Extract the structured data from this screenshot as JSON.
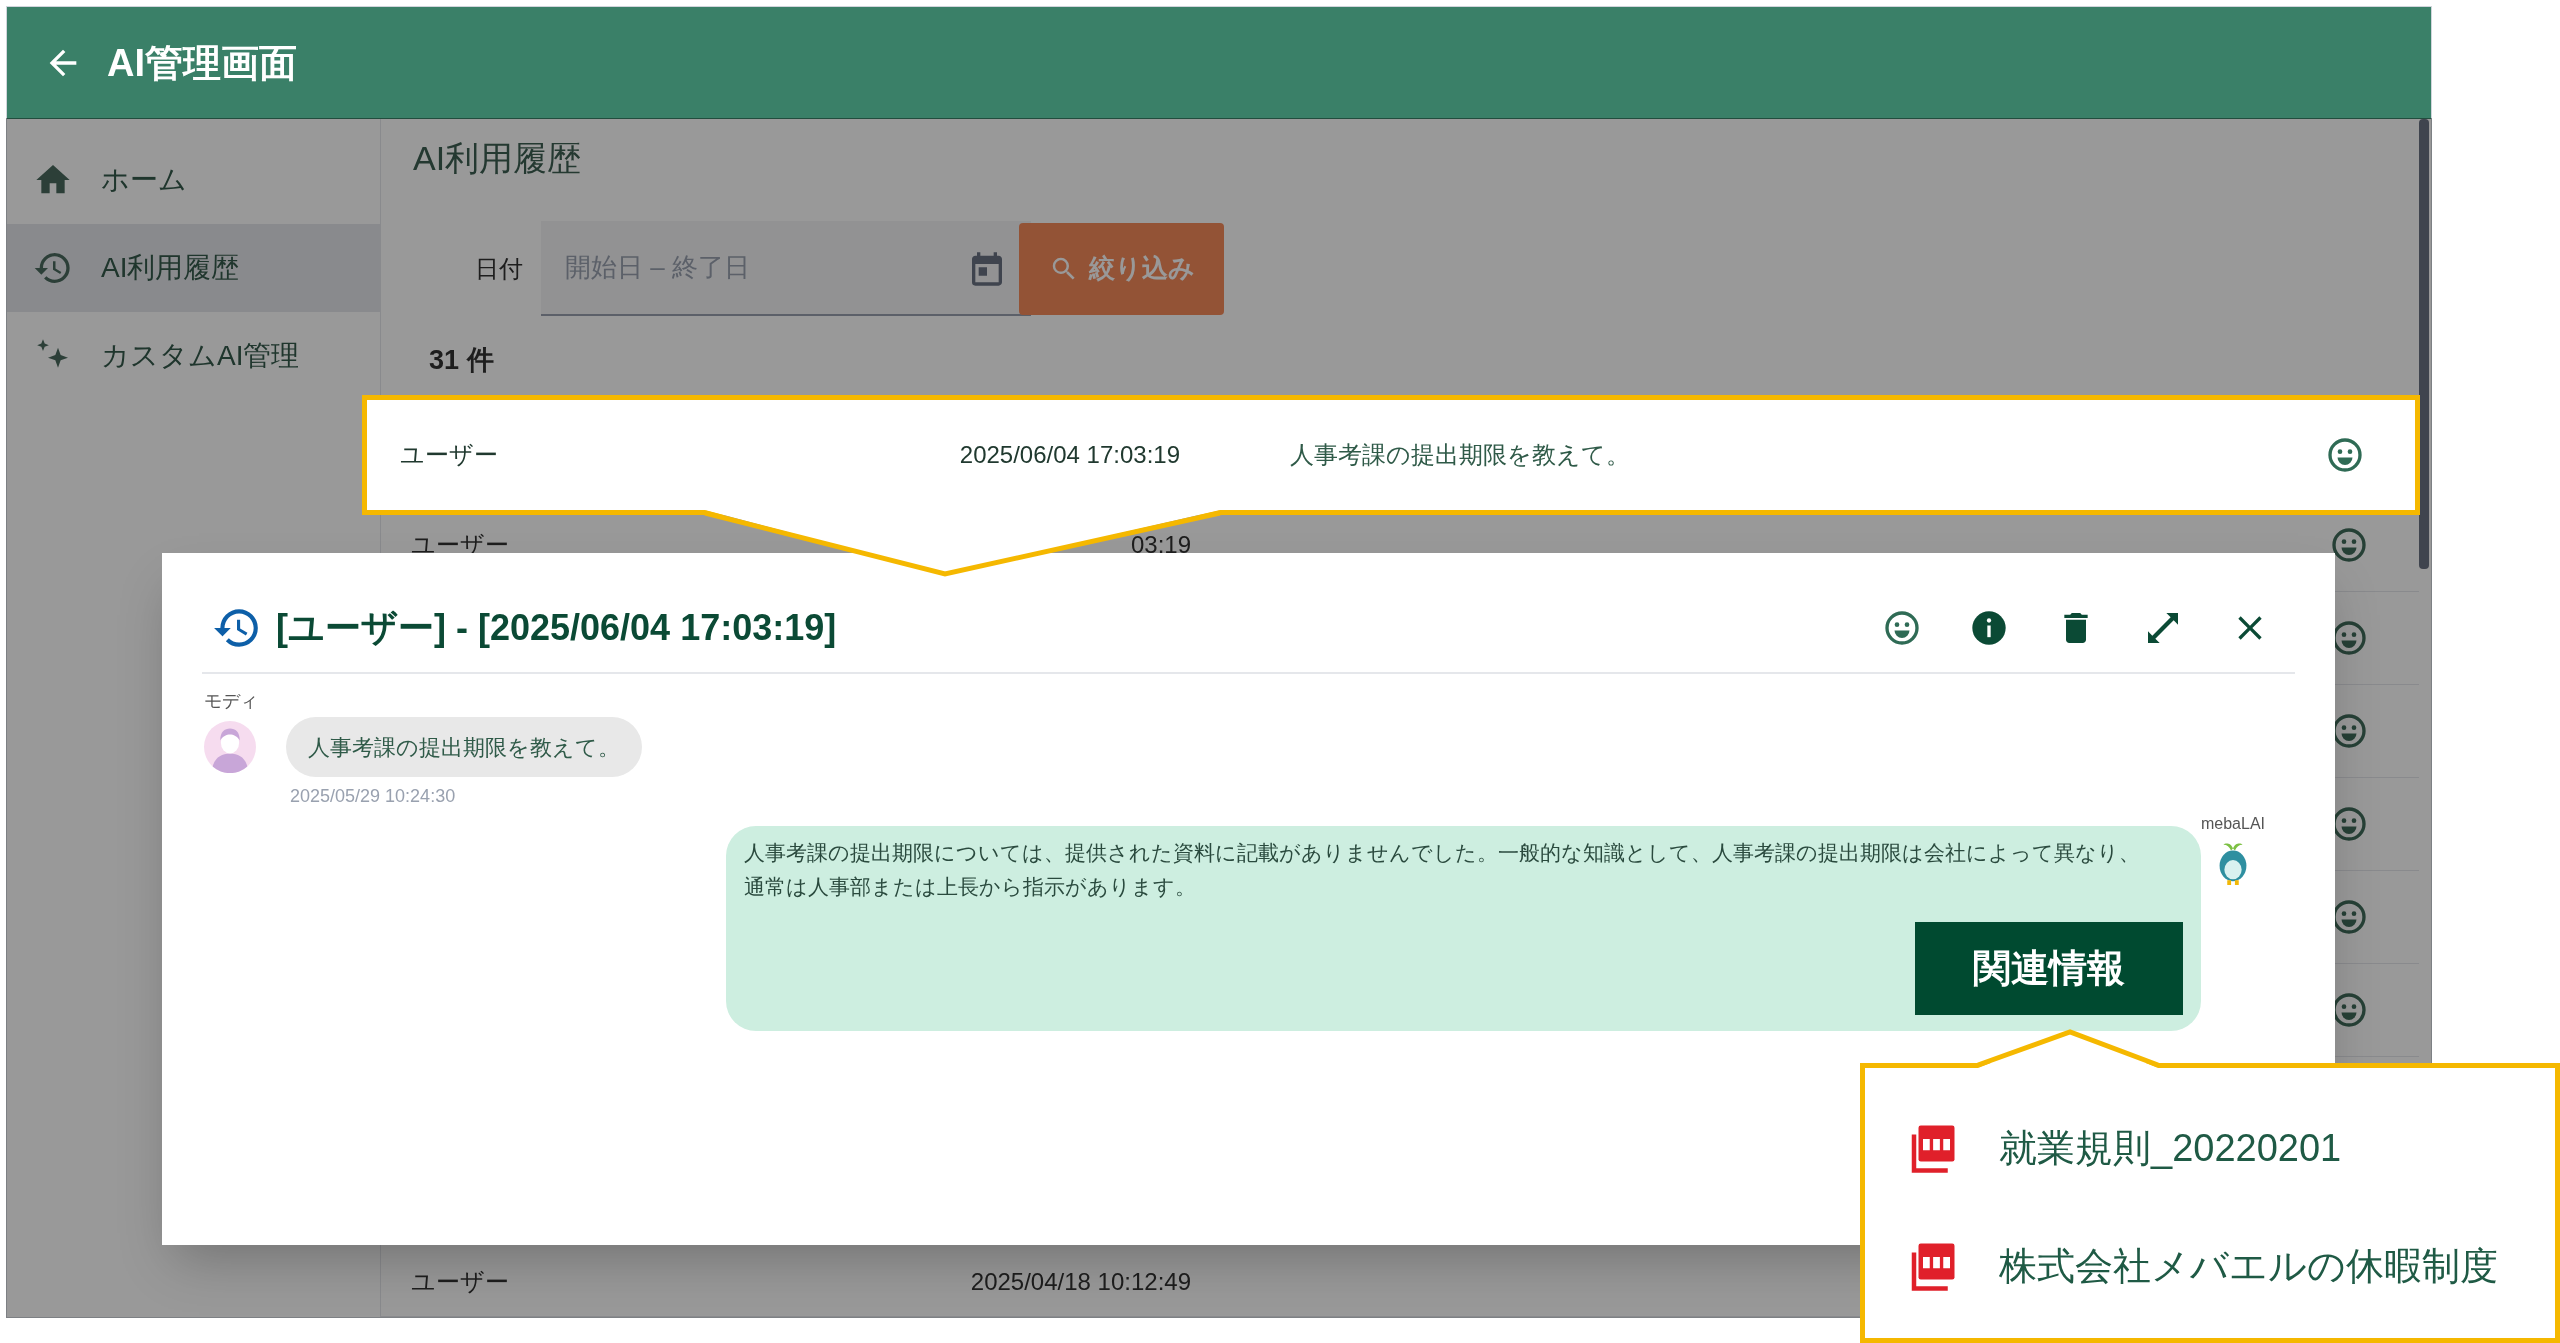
{
  "app_bar": {
    "title": "AI管理画面"
  },
  "sidebar": {
    "items": [
      {
        "kind": "home",
        "label": "ホーム",
        "selected": false
      },
      {
        "kind": "history",
        "label": "AI利用履歴",
        "selected": true
      },
      {
        "kind": "sparkle",
        "label": "カスタムAI管理",
        "selected": false
      }
    ]
  },
  "page": {
    "title": "AI利用履歴",
    "date_label": "日付",
    "date_field": {
      "placeholder": "開始日 – 終了日"
    },
    "filter_button": "絞り込み",
    "count": "31 件"
  },
  "history_rows": [
    {
      "user": "ユーザー",
      "datetime": "2025/06/04 17:03:19",
      "message": "人事考課の提出期限を教えて。",
      "rating_icon": true,
      "highlighted": true
    },
    {
      "user": "ユーザー",
      "datetime": "03:19",
      "rating_icon": true,
      "highlighted": false
    },
    {
      "rating_icon": true,
      "highlighted": false
    },
    {
      "rating_icon": true,
      "highlighted": false
    },
    {
      "rating_icon": true,
      "highlighted": false
    },
    {
      "rating_icon": true,
      "highlighted": false
    },
    {
      "rating_icon": true,
      "highlighted": false
    },
    {
      "user": "ユーザー",
      "datetime": "2025/04/18 10:12:49",
      "rating_icon": false,
      "highlighted": false
    }
  ],
  "dialog": {
    "title": "[ユーザー] - [2025/06/04 17:03:19]",
    "messages": [
      {
        "kind": "user",
        "sender": "モディ",
        "text": "人事考課の提出期限を教えて。",
        "time": "2025/05/29 10:24:30"
      },
      {
        "kind": "ai",
        "sender": "mebaLAI",
        "text": "人事考課の提出期限については、提供された資料に記載がありませんでした。一般的な知識として、人事考課の提出期限は会社によって異なり、通常は人事部または上長から指示があります。",
        "button": "関連情報"
      }
    ]
  },
  "related_popup": {
    "items": [
      {
        "kind": "pdf",
        "label": "就業規則_20220201"
      },
      {
        "kind": "pdf",
        "label": "株式会社メバエルの休暇制度"
      }
    ]
  }
}
